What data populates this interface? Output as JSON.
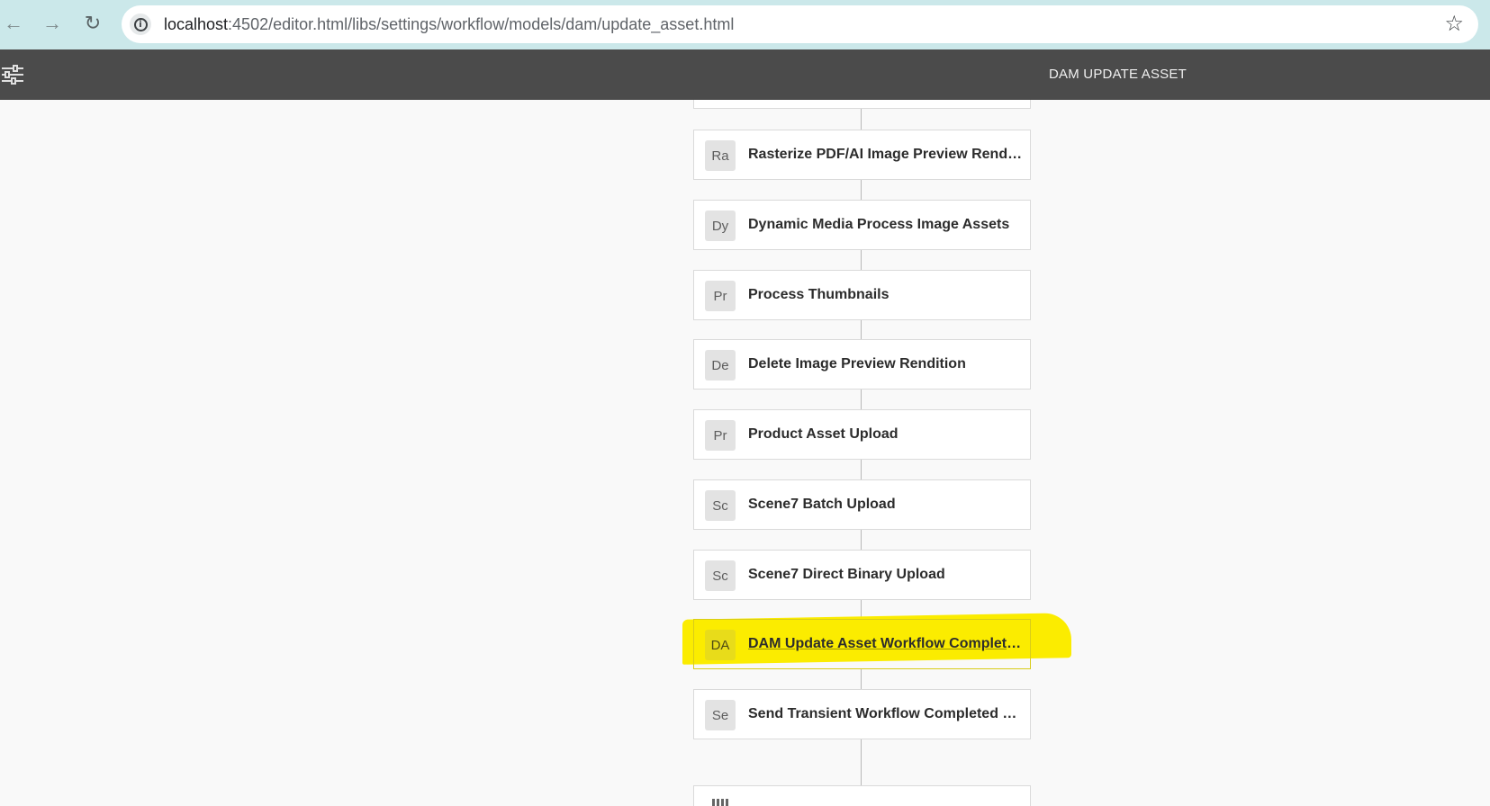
{
  "browser": {
    "url_host": "localhost",
    "url_rest": ":4502/editor.html/libs/settings/workflow/models/dam/update_asset.html",
    "back_icon": "←",
    "forward_icon": "→",
    "reload_icon": "↻",
    "info_icon": "i",
    "star_icon": "☆"
  },
  "toolbar": {
    "title": "DAM UPDATE ASSET"
  },
  "steps": [
    {
      "badge": "",
      "title": ""
    },
    {
      "badge": "Ra",
      "title": "Rasterize PDF/AI Image Preview Rendi..."
    },
    {
      "badge": "Dy",
      "title": "Dynamic Media Process Image Assets"
    },
    {
      "badge": "Pr",
      "title": "Process Thumbnails"
    },
    {
      "badge": "De",
      "title": "Delete Image Preview Rendition"
    },
    {
      "badge": "Pr",
      "title": "Product Asset Upload"
    },
    {
      "badge": "Sc",
      "title": "Scene7 Batch Upload"
    },
    {
      "badge": "Sc",
      "title": "Scene7 Direct Binary Upload"
    },
    {
      "badge": "DA",
      "title": "DAM Update Asset Workflow Completed"
    },
    {
      "badge": "Se",
      "title": "Send Transient Workflow Completed E..."
    }
  ],
  "colors": {
    "highlight": "#fbec00",
    "toolbar": "#4b4b4b",
    "browser_bar": "#cbe8ea"
  }
}
